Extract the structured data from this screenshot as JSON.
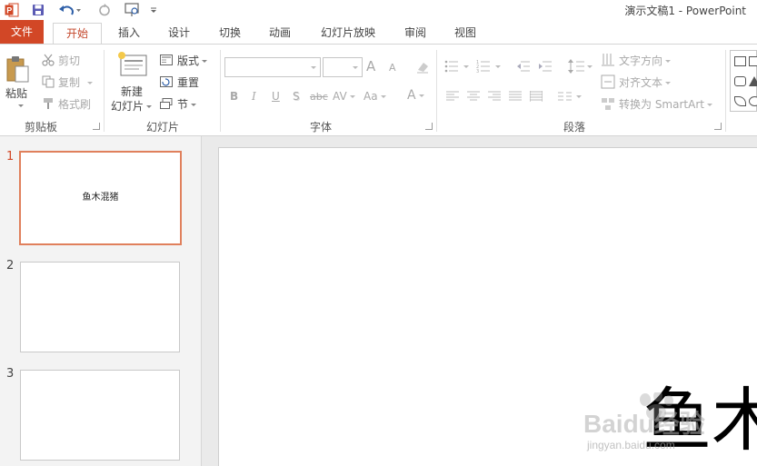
{
  "titlebar": {
    "title": "演示文稿1 - PowerPoint"
  },
  "tabs": [
    {
      "label": "文件"
    },
    {
      "label": "开始"
    },
    {
      "label": "插入"
    },
    {
      "label": "设计"
    },
    {
      "label": "切换"
    },
    {
      "label": "动画"
    },
    {
      "label": "幻灯片放映"
    },
    {
      "label": "审阅"
    },
    {
      "label": "视图"
    }
  ],
  "ribbon": {
    "clipboard": {
      "label": "剪贴板",
      "paste": "粘贴",
      "cut": "剪切",
      "copy": "复制",
      "format_painter": "格式刷"
    },
    "slides": {
      "label": "幻灯片",
      "new_slide_line1": "新建",
      "new_slide_line2": "幻灯片",
      "layout": "版式",
      "reset": "重置",
      "section": "节"
    },
    "font": {
      "label": "字体",
      "bold": "B",
      "italic": "I",
      "underline": "U",
      "shadow": "S",
      "strike": "abc",
      "spacing": "AV",
      "case": "Aa",
      "color": "A",
      "grow": "A",
      "shrink": "A"
    },
    "paragraph": {
      "label": "段落",
      "text_direction": "文字方向",
      "align_text": "对齐文本",
      "convert_smartart": "转换为 SmartArt"
    }
  },
  "thumbnails": [
    {
      "number": "1",
      "text": "鱼木混猪",
      "selected": true
    },
    {
      "number": "2",
      "text": ""
    },
    {
      "number": "3",
      "text": ""
    }
  ],
  "slide": {
    "title": "鱼木"
  },
  "watermark": {
    "brand": "Baidu经验",
    "url": "jingyan.baidu.com"
  },
  "colors": {
    "accent": "#d24726",
    "home_tab_text": "#c4462a",
    "selected_border": "#e0805c"
  }
}
